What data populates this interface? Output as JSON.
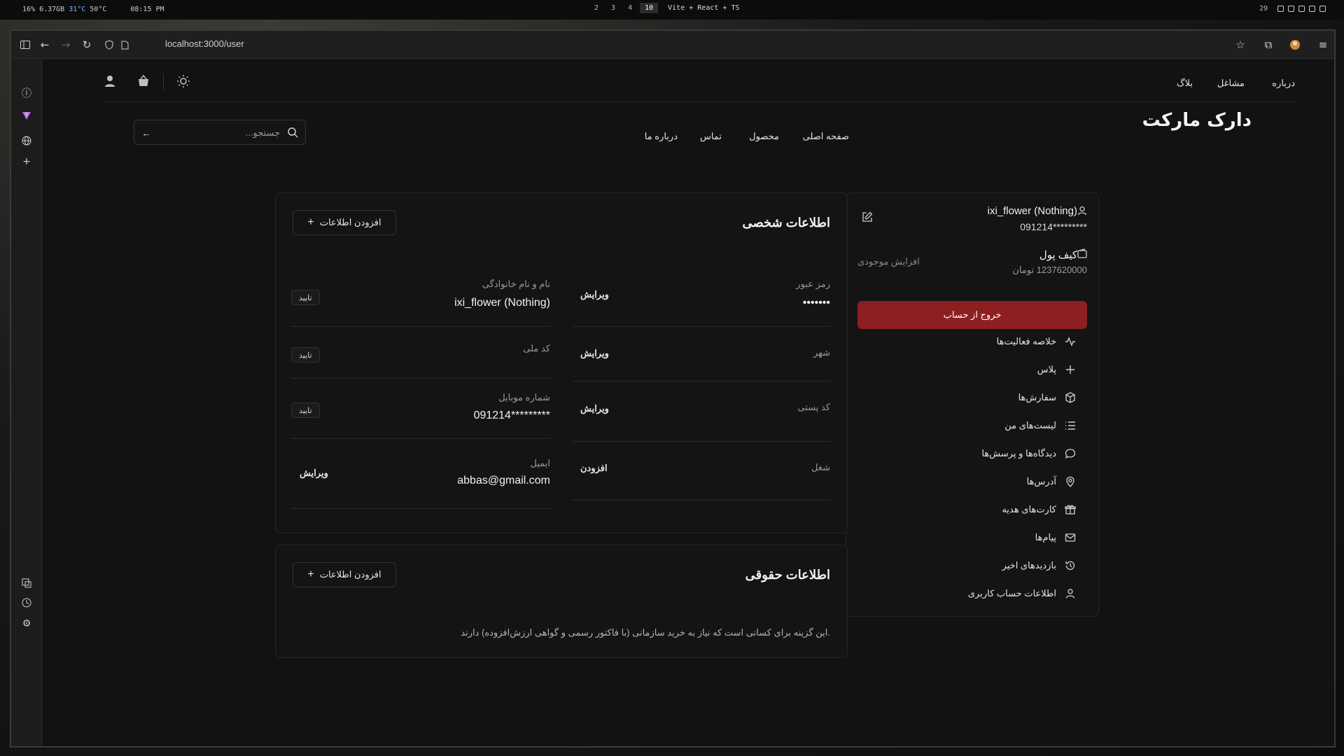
{
  "system_bar": {
    "stats": [
      "16%",
      "6.37GB",
      "31°C",
      "50°C",
      "08:15 PM"
    ],
    "workspaces": [
      "2",
      "3",
      "4",
      "10"
    ],
    "active_workspace": "10",
    "window_title": "Vite + React + TS",
    "volume": "29"
  },
  "browser": {
    "url": "localhost:3000/user"
  },
  "site": {
    "logo": "دارک مارکت",
    "top_links": [
      "درباره",
      "مشاغل",
      "بلاگ"
    ],
    "main_nav": [
      "صفحه اصلی",
      "محصول",
      "تماس",
      "درباره ما"
    ],
    "search_placeholder": "جستجو..."
  },
  "profile": {
    "username": "ixi_flower (Nothing)",
    "phone": "091214*********",
    "wallet_label": "کیف پول",
    "wallet_balance": "1237620000 تومان",
    "increase_balance": "افزایش موجودی",
    "logout": "خروج از حساب",
    "menu": [
      {
        "label": "خلاصه فعالیت‌ها",
        "icon": "activity-icon"
      },
      {
        "label": "پلاس",
        "icon": "plus-icon"
      },
      {
        "label": "سفارش‌ها",
        "icon": "box-icon"
      },
      {
        "label": "لیست‌های من",
        "icon": "list-icon"
      },
      {
        "label": "دیدگاه‌ها و پرسش‌ها",
        "icon": "comment-icon"
      },
      {
        "label": "آدرس‌ها",
        "icon": "map-pin-icon"
      },
      {
        "label": "کارت‌های هدیه",
        "icon": "gift-icon"
      },
      {
        "label": "پیام‌ها",
        "icon": "mail-icon"
      },
      {
        "label": "بازدیدهای اخیر",
        "icon": "history-icon"
      },
      {
        "label": "اطلاعات حساب کاربری",
        "icon": "user-icon"
      }
    ]
  },
  "personal_info": {
    "title": "اطلاعات شخصی",
    "add_button": "افزودن اطلاعات",
    "fields": {
      "full_name": {
        "label": "نام و نام خانوادگی",
        "value": "ixi_flower (Nothing)",
        "chip": "تایید"
      },
      "national_code": {
        "label": "کد ملی",
        "value": "",
        "chip": "تایید"
      },
      "mobile": {
        "label": "شماره موبایل",
        "value": "091214*********",
        "chip": "تایید"
      },
      "email": {
        "label": "ایمیل",
        "value": "abbas@gmail.com",
        "action": "ویرایش"
      },
      "password": {
        "label": "رمز عبور",
        "value": "•••••••",
        "action": "ویرایش"
      },
      "city": {
        "label": "شهر",
        "value": "",
        "action": "ویرایش"
      },
      "postal_code": {
        "label": "کد پستی",
        "value": "",
        "action": "ویرایش"
      },
      "job": {
        "label": "شغل",
        "value": "",
        "action": "افزودن"
      }
    }
  },
  "legal_info": {
    "title": "اطلاعات حقوقی",
    "add_button": "افزودن اطلاعات",
    "description": ".این گزینه برای کسانی است که نیاز به خرید سازمانی (با فاکتور رسمی و گواهی ارزش‌افزوده) دارند"
  },
  "colors": {
    "logout_bg": "#8e1f20",
    "page_bg": "#121212",
    "card_bg": "#141414"
  }
}
